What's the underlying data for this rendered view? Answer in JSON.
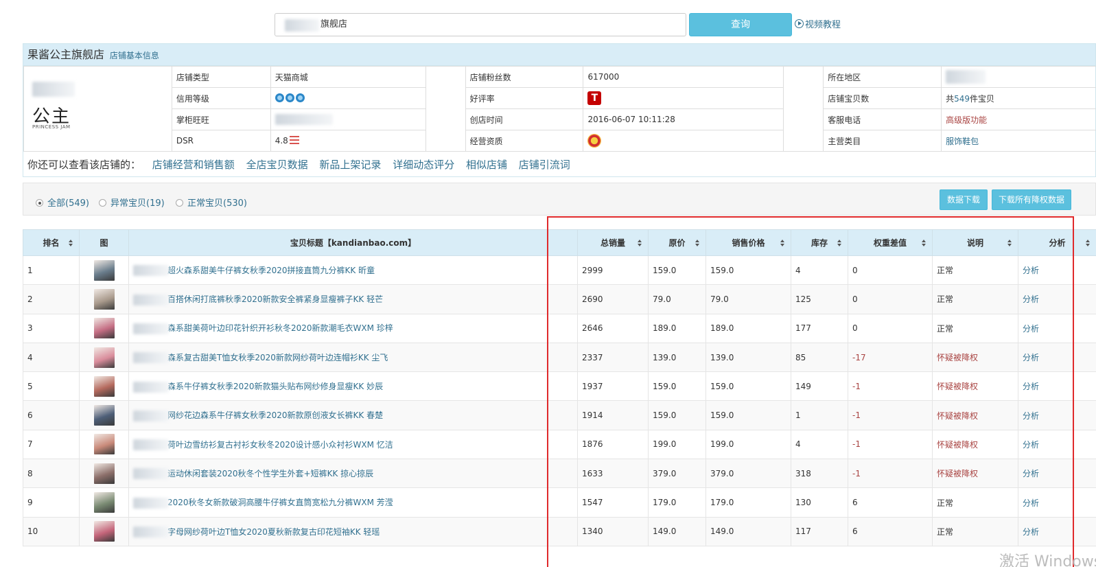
{
  "search": {
    "value": "旗舰店",
    "button": "查询",
    "video_link": "视频教程"
  },
  "shop": {
    "name": "果酱公主旗舰店",
    "sub": "店铺基本信息",
    "logo_text": "公主",
    "logo_small": "PRINCESS JAM",
    "info": {
      "type_label": "店铺类型",
      "type_value": "天猫商城",
      "fans_label": "店铺粉丝数",
      "fans_value": "617000",
      "region_label": "所在地区",
      "credit_label": "信用等级",
      "rate_label": "好评率",
      "rate_badge": "T",
      "count_label": "店铺宝贝数",
      "count_prefix": "共",
      "count_value": "549",
      "count_suffix": "件宝贝",
      "wangwang_label": "掌柜旺旺",
      "open_label": "创店时间",
      "open_value": "2016-06-07 10:11:28",
      "phone_label": "客服电话",
      "phone_value": "高级版功能",
      "dsr_label": "DSR",
      "dsr_value": "4.8",
      "license_label": "经营资质",
      "category_label": "主营类目",
      "category_value": "服饰鞋包"
    },
    "more_lead": "你还可以查看该店铺的：",
    "more_links": [
      "店铺经营和销售额",
      "全店宝贝数据",
      "新品上架记录",
      "详细动态评分",
      "相似店铺",
      "店铺引流词"
    ]
  },
  "filters": {
    "all": "全部(549)",
    "abnormal": "异常宝贝(19)",
    "normal": "正常宝贝(530)",
    "download": "数据下载",
    "download_all": "下载所有降权数据"
  },
  "table": {
    "headers": [
      "排名",
      "图",
      "宝贝标题【kandianbao.com】",
      "总销量",
      "原价",
      "销售价格",
      "库存",
      "权重差值",
      "说明",
      "分析"
    ],
    "rows": [
      {
        "rank": "1",
        "title": "超火森系甜美牛仔裤女秋季2020拼接直筒九分裤KK 昕童",
        "sales": "2999",
        "orig": "159.0",
        "price": "159.0",
        "stock": "4",
        "diff": "0",
        "note": "正常",
        "analyze": "分析",
        "thumb": "#6a7d8c"
      },
      {
        "rank": "2",
        "title": "百搭休闲打底裤秋季2020新款安全裤紧身显瘦裤子KK 轻芒",
        "sales": "2690",
        "orig": "79.0",
        "price": "79.0",
        "stock": "125",
        "diff": "0",
        "note": "正常",
        "analyze": "分析",
        "thumb": "#a99a8c"
      },
      {
        "rank": "3",
        "title": "森系甜美荷叶边印花针织开衫秋冬2020新款潮毛衣WXM 珍梓",
        "sales": "2646",
        "orig": "189.0",
        "price": "189.0",
        "stock": "177",
        "diff": "0",
        "note": "正常",
        "analyze": "分析",
        "thumb": "#c46d83"
      },
      {
        "rank": "4",
        "title": "森系复古甜美T恤女秋季2020新款网纱荷叶边连帽衫KK 尘飞",
        "sales": "2337",
        "orig": "139.0",
        "price": "139.0",
        "stock": "85",
        "diff": "-17",
        "note": "怀疑被降权",
        "analyze": "分析",
        "thumb": "#d98c9b"
      },
      {
        "rank": "5",
        "title": "森系牛仔裤女秋季2020新款猫头贴布网纱修身显瘦KK 妙辰",
        "sales": "1937",
        "orig": "159.0",
        "price": "159.0",
        "stock": "149",
        "diff": "-1",
        "note": "怀疑被降权",
        "analyze": "分析",
        "thumb": "#b56a5e"
      },
      {
        "rank": "6",
        "title": "网纱花边森系牛仔裤女秋季2020新款原创液女长裤KK 春楚",
        "sales": "1914",
        "orig": "159.0",
        "price": "159.0",
        "stock": "1",
        "diff": "-1",
        "note": "怀疑被降权",
        "analyze": "分析",
        "thumb": "#4e5f78"
      },
      {
        "rank": "7",
        "title": "荷叶边雪纺衫复古衬衫女秋冬2020设计感小众衬衫WXM 忆洁",
        "sales": "1876",
        "orig": "199.0",
        "price": "199.0",
        "stock": "4",
        "diff": "-1",
        "note": "怀疑被降权",
        "analyze": "分析",
        "thumb": "#c98a7a"
      },
      {
        "rank": "8",
        "title": "运动休闲套装2020秋冬个性学生外套+短裤KK 掠心掠辰",
        "sales": "1633",
        "orig": "379.0",
        "price": "379.0",
        "stock": "318",
        "diff": "-1",
        "note": "怀疑被降权",
        "analyze": "分析",
        "thumb": "#8c6f6a"
      },
      {
        "rank": "9",
        "title": "2020秋冬女新款破洞高腰牛仔裤女直筒宽松九分裤WXM 芳滢",
        "sales": "1547",
        "orig": "179.0",
        "price": "179.0",
        "stock": "130",
        "diff": "6",
        "note": "正常",
        "analyze": "分析",
        "thumb": "#7a8b73"
      },
      {
        "rank": "10",
        "title": "字母网纱荷叶边T恤女2020夏秋新款复古印花短袖KK 轻瑶",
        "sales": "1340",
        "orig": "149.0",
        "price": "149.0",
        "stock": "117",
        "diff": "6",
        "note": "正常",
        "analyze": "分析",
        "thumb": "#c4657a"
      }
    ]
  },
  "watermark": "激活 Windows"
}
